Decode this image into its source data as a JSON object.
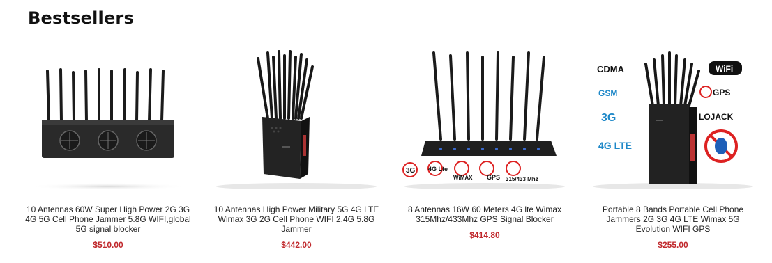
{
  "section": {
    "title": "Bestsellers"
  },
  "products": [
    {
      "name": "10 Antennas 60W Super High Power 2G 3G 4G 5G Cell Phone Jammer 5.8G WIFI,global 5G signal blocker",
      "price": "$510.00",
      "image_icon": "desktop-jammer-10-antennas"
    },
    {
      "name": "10 Antennas High Power Military 5G 4G LTE Wimax 3G 2G Cell Phone WIFI 2.4G 5.8G Jammer",
      "price": "$442.00",
      "image_icon": "handheld-jammer-10-antennas"
    },
    {
      "name": "8 Antennas 16W 60 Meters 4G lte Wimax 315Mhz/433Mhz GPS Signal Blocker",
      "price": "$414.80",
      "image_icon": "desktop-jammer-8-antennas",
      "badges": [
        "3G",
        "4G Lte",
        "WiMAX",
        "GPS",
        "315/433 Mhz"
      ]
    },
    {
      "name": "Portable 8 Bands Portable Cell Phone Jammers 2G 3G 4G LTE Wimax 5G Evolution WIFI GPS",
      "price": "$255.00",
      "image_icon": "handheld-jammer-8-bands",
      "badges": [
        "CDMA",
        "WiFi",
        "GSM",
        "GPS",
        "3G",
        "LOJACK",
        "4G LTE"
      ]
    }
  ]
}
